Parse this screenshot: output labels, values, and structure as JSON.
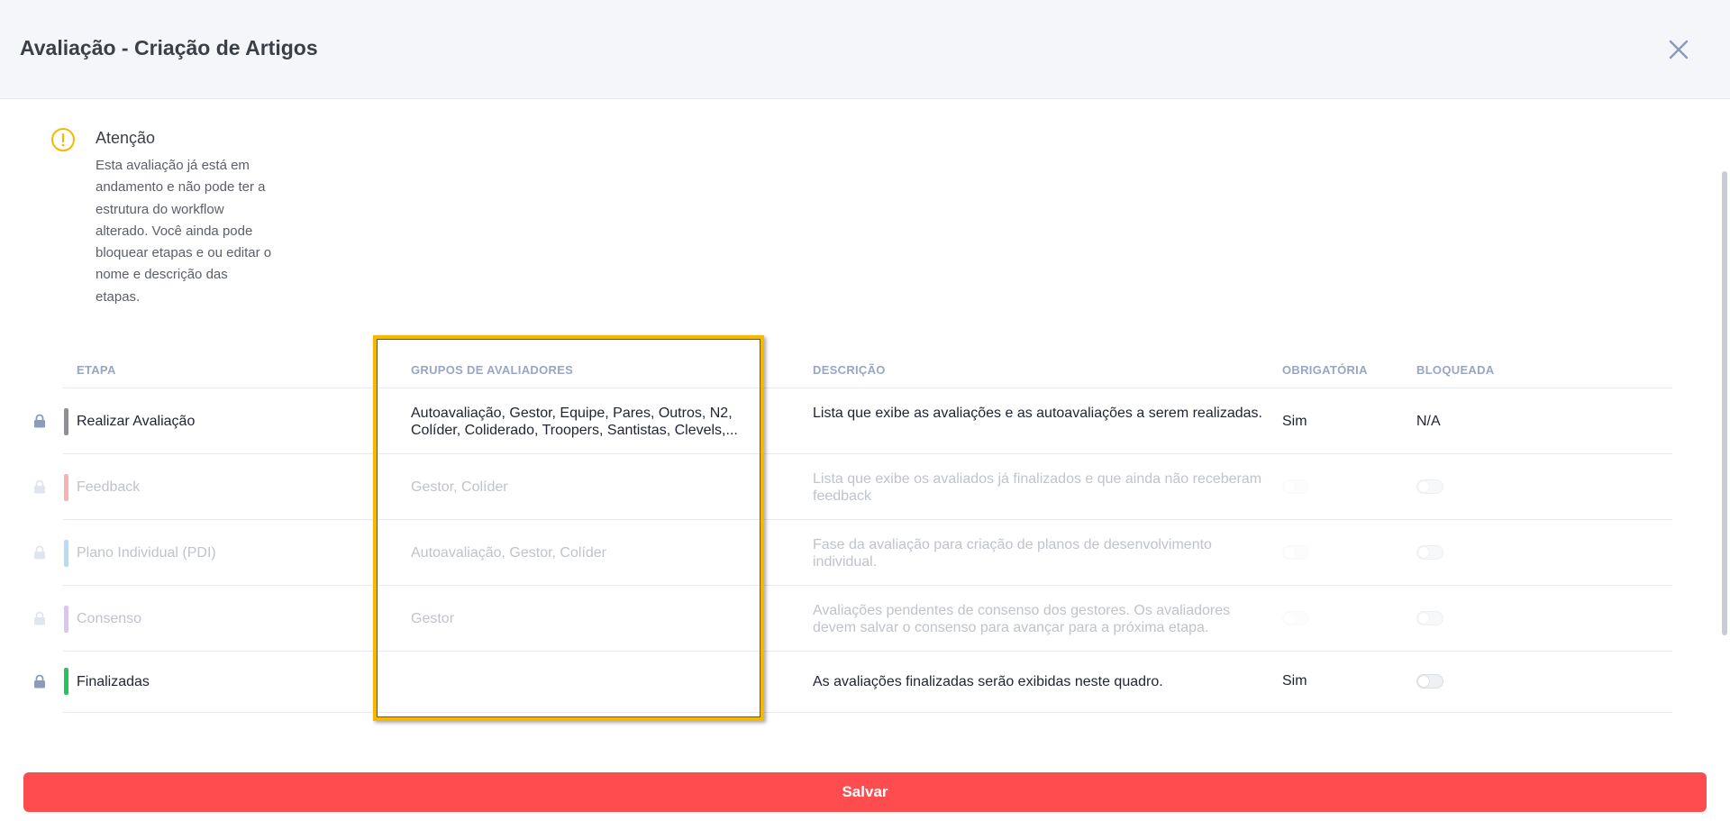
{
  "header": {
    "title": "Avaliação - Criação de Artigos"
  },
  "alert": {
    "title": "Atenção",
    "text": "Esta avaliação já está em andamento e não pode ter a estrutura do workflow alterado. Você ainda pode bloquear etapas e ou editar o nome e descrição das etapas."
  },
  "table": {
    "headers": {
      "etapa": "ETAPA",
      "grupos": "GRUPOS DE AVALIADORES",
      "descricao": "DESCRIÇÃO",
      "obrigatoria": "OBRIGATÓRIA",
      "bloqueada": "BLOQUEADA"
    },
    "rows": [
      {
        "etapa": "Realizar Avaliação",
        "grupos": "Autoavaliação, Gestor, Equipe, Pares, Outros, N2, Colíder, Coliderado, Troopers, Santistas, Clevels,...",
        "descricao": "Lista que exibe as avaliações e as autoavaliações a serem realizadas.",
        "obrigatoria": "Sim",
        "bloqueada": "N/A",
        "bar_color": "#8e9096"
      },
      {
        "etapa": "Feedback",
        "grupos": "Gestor, Colíder",
        "descricao": "Lista que exibe os avaliados já finalizados e que ainda não receberam feedback",
        "obrigatoria": "",
        "bloqueada": "",
        "bar_color": "#f6b3b3"
      },
      {
        "etapa": "Plano Individual (PDI)",
        "grupos": "Autoavaliação, Gestor, Colíder",
        "descricao": "Fase da avaliação para criação de planos de desenvolvimento individual.",
        "obrigatoria": "",
        "bloqueada": "",
        "bar_color": "#b7dcf4"
      },
      {
        "etapa": "Consenso",
        "grupos": "Gestor",
        "descricao": "Avaliações pendentes de consenso dos gestores. Os avaliadores devem salvar o consenso para avançar para a próxima etapa.",
        "obrigatoria": "",
        "bloqueada": "",
        "bar_color": "#dcc3f4"
      },
      {
        "etapa": "Finalizadas",
        "grupos": "",
        "descricao": "As avaliações finalizadas serão exibidas neste quadro.",
        "obrigatoria": "Sim",
        "bloqueada": "",
        "bar_color": "#22c55e"
      }
    ]
  },
  "footer": {
    "save_label": "Salvar"
  },
  "colors": {
    "accent": "#ff4d4f",
    "highlight": "#f5b800",
    "alert": "#f5b800"
  }
}
